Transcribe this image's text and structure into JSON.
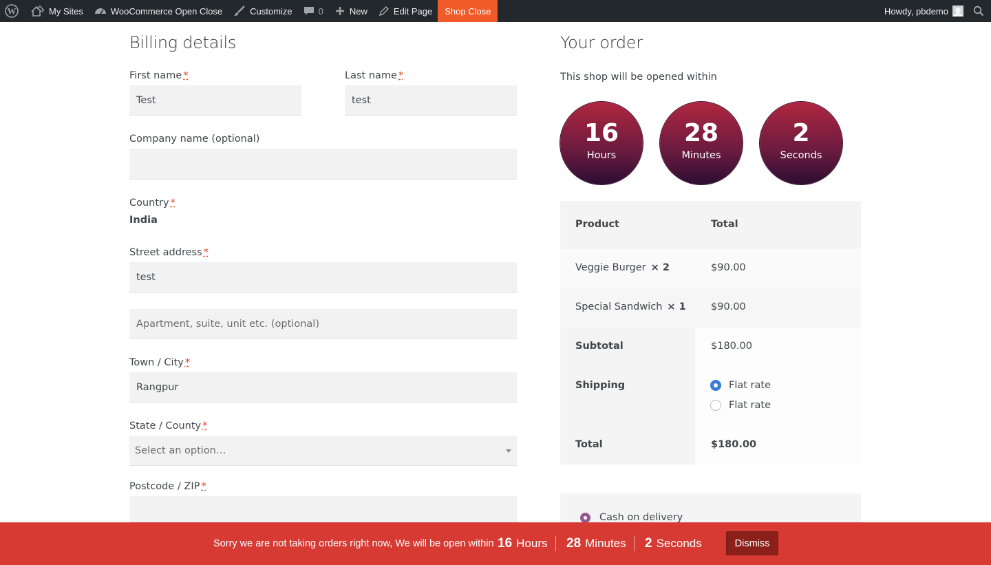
{
  "adminbar": {
    "my_sites": "My Sites",
    "site_name": "WooCommerce Open Close",
    "customize": "Customize",
    "comments_count": "0",
    "new": "New",
    "edit_page": "Edit Page",
    "shop_close": "Shop Close",
    "howdy": "Howdy, pbdemo",
    "accent_color": "#f05a28"
  },
  "billing": {
    "title": "Billing details",
    "required_mark": "*",
    "first_name": {
      "label": "First name",
      "value": "Test"
    },
    "last_name": {
      "label": "Last name",
      "value": "test"
    },
    "company": {
      "label": "Company name (optional)",
      "value": ""
    },
    "country": {
      "label": "Country",
      "value": "India"
    },
    "street": {
      "label": "Street address",
      "value": "test",
      "apartment_placeholder": "Apartment, suite, unit etc. (optional)"
    },
    "town": {
      "label": "Town / City",
      "value": "Rangpur"
    },
    "state": {
      "label": "State / County",
      "placeholder": "Select an option…"
    },
    "postcode": {
      "label": "Postcode / ZIP",
      "value": ""
    }
  },
  "order": {
    "title": "Your order",
    "countdown_text": "This shop will be opened within",
    "countdown": [
      {
        "value": "16",
        "unit": "Hours"
      },
      {
        "value": "28",
        "unit": "Minutes"
      },
      {
        "value": "2",
        "unit": "Seconds"
      }
    ],
    "table": {
      "col_product": "Product",
      "col_total": "Total",
      "items": [
        {
          "name": "Veggie Burger",
          "qty": "× 2",
          "total": "$90.00"
        },
        {
          "name": "Special Sandwich",
          "qty": "× 1",
          "total": "$90.00"
        }
      ],
      "subtotal_label": "Subtotal",
      "subtotal": "$180.00",
      "shipping_label": "Shipping",
      "shipping_options": [
        {
          "label": "Flat rate",
          "selected": true
        },
        {
          "label": "Flat rate",
          "selected": false
        }
      ],
      "total_label": "Total",
      "total": "$180.00"
    },
    "payment_method": "Cash on delivery"
  },
  "notice": {
    "message": "Sorry we are not taking orders right now, We will be open within",
    "hours": "16",
    "hours_unit": "Hours",
    "minutes": "28",
    "minutes_unit": "Minutes",
    "seconds": "2",
    "seconds_unit": "Seconds",
    "dismiss": "Dismiss",
    "bg_color": "#d63a33"
  }
}
